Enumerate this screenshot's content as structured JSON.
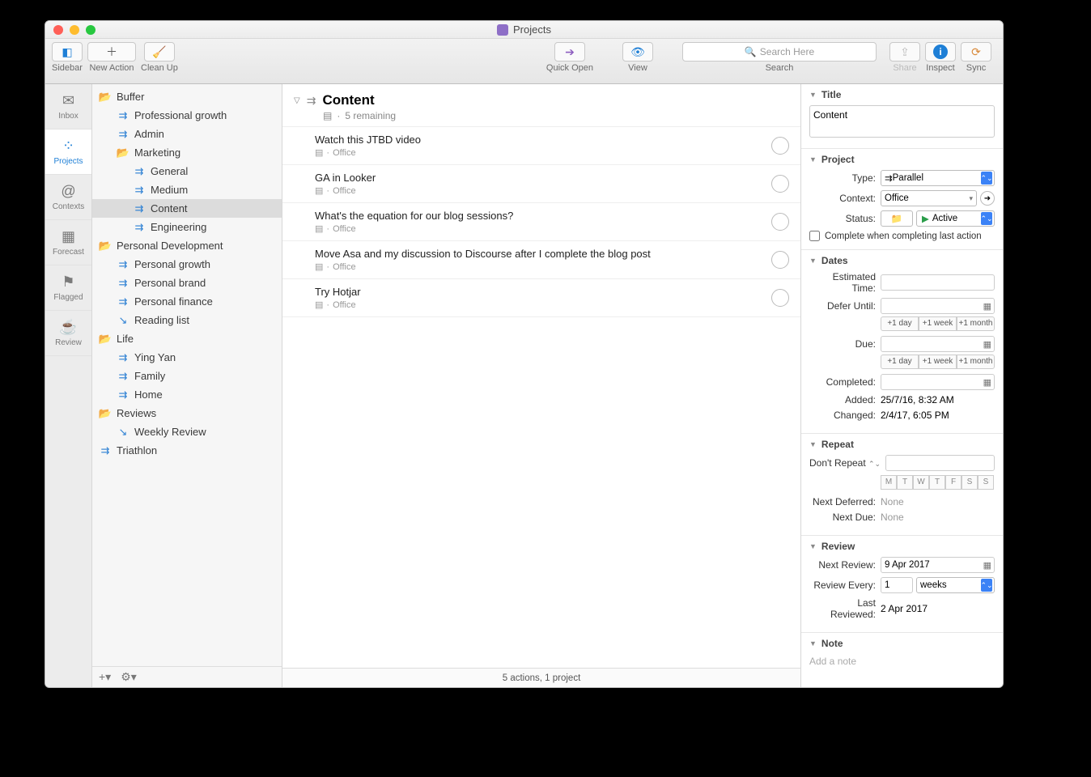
{
  "window": {
    "title": "Projects"
  },
  "toolbar": {
    "sidebar": "Sidebar",
    "new_action": "New Action",
    "clean_up": "Clean Up",
    "quick_open": "Quick Open",
    "view": "View",
    "search_placeholder": "Search Here",
    "search_label": "Search",
    "share": "Share",
    "inspect": "Inspect",
    "sync": "Sync"
  },
  "perspectives": [
    {
      "id": "inbox",
      "label": "Inbox",
      "glyph": "✉"
    },
    {
      "id": "projects",
      "label": "Projects",
      "glyph": "⁘"
    },
    {
      "id": "contexts",
      "label": "Contexts",
      "glyph": "@"
    },
    {
      "id": "forecast",
      "label": "Forecast",
      "glyph": "▦"
    },
    {
      "id": "flagged",
      "label": "Flagged",
      "glyph": "⚑"
    },
    {
      "id": "review",
      "label": "Review",
      "glyph": "☕"
    }
  ],
  "active_perspective": "projects",
  "tree": [
    {
      "lvl": 0,
      "type": "folder",
      "label": "Buffer"
    },
    {
      "lvl": 1,
      "type": "project",
      "label": "Professional growth"
    },
    {
      "lvl": 1,
      "type": "project",
      "label": "Admin"
    },
    {
      "lvl": 1,
      "type": "folder",
      "label": "Marketing"
    },
    {
      "lvl": 2,
      "type": "project",
      "label": "General"
    },
    {
      "lvl": 2,
      "type": "project",
      "label": "Medium"
    },
    {
      "lvl": 2,
      "type": "project",
      "label": "Content",
      "selected": true
    },
    {
      "lvl": 2,
      "type": "project",
      "label": "Engineering"
    },
    {
      "lvl": 0,
      "type": "folder",
      "label": "Personal Development"
    },
    {
      "lvl": 1,
      "type": "project",
      "label": "Personal growth"
    },
    {
      "lvl": 1,
      "type": "project",
      "label": "Personal brand"
    },
    {
      "lvl": 1,
      "type": "project",
      "label": "Personal finance"
    },
    {
      "lvl": 1,
      "type": "list",
      "label": "Reading list"
    },
    {
      "lvl": 0,
      "type": "folder",
      "label": "Life"
    },
    {
      "lvl": 1,
      "type": "project",
      "label": "Ying Yan"
    },
    {
      "lvl": 1,
      "type": "project",
      "label": "Family"
    },
    {
      "lvl": 1,
      "type": "project",
      "label": "Home"
    },
    {
      "lvl": 0,
      "type": "folder",
      "label": "Reviews"
    },
    {
      "lvl": 1,
      "type": "list",
      "label": "Weekly Review"
    },
    {
      "lvl": 0,
      "type": "project",
      "label": "Triathlon"
    }
  ],
  "content": {
    "title": "Content",
    "subtitle": "5 remaining",
    "tasks": [
      {
        "title": "Watch this JTBD video",
        "context": "Office"
      },
      {
        "title": "GA in Looker",
        "context": "Office"
      },
      {
        "title": "What's the equation for our blog sessions?",
        "context": "Office"
      },
      {
        "title": "Move Asa and my discussion to Discourse after I complete the blog post",
        "context": "Office"
      },
      {
        "title": "Try Hotjar",
        "context": "Office"
      }
    ]
  },
  "statusbar": "5 actions, 1 project",
  "inspector": {
    "title_header": "Title",
    "title_value": "Content",
    "project_header": "Project",
    "type_label": "Type:",
    "type_value": "Parallel",
    "context_label": "Context:",
    "context_value": "Office",
    "status_label": "Status:",
    "status_value": "Active",
    "complete_checkbox": "Complete when completing last action",
    "dates_header": "Dates",
    "est_label": "Estimated Time:",
    "defer_label": "Defer Until:",
    "due_label": "Due:",
    "completed_label": "Completed:",
    "plus1d": "+1 day",
    "plus1w": "+1 week",
    "plus1m": "+1 month",
    "added_label": "Added:",
    "added_value": "25/7/16, 8:32 AM",
    "changed_label": "Changed:",
    "changed_value": "2/4/17, 6:05 PM",
    "repeat_header": "Repeat",
    "repeat_mode": "Don't Repeat",
    "days": [
      "M",
      "T",
      "W",
      "T",
      "F",
      "S",
      "S"
    ],
    "next_def_label": "Next Deferred:",
    "next_def_value": "None",
    "next_due_label": "Next Due:",
    "next_due_value": "None",
    "review_header": "Review",
    "next_review_label": "Next Review:",
    "next_review_value": "9 Apr 2017",
    "review_every_label": "Review Every:",
    "review_every_num": "1",
    "review_every_unit": "weeks",
    "last_reviewed_label": "Last Reviewed:",
    "last_reviewed_value": "2 Apr 2017",
    "note_header": "Note",
    "note_placeholder": "Add a note"
  }
}
